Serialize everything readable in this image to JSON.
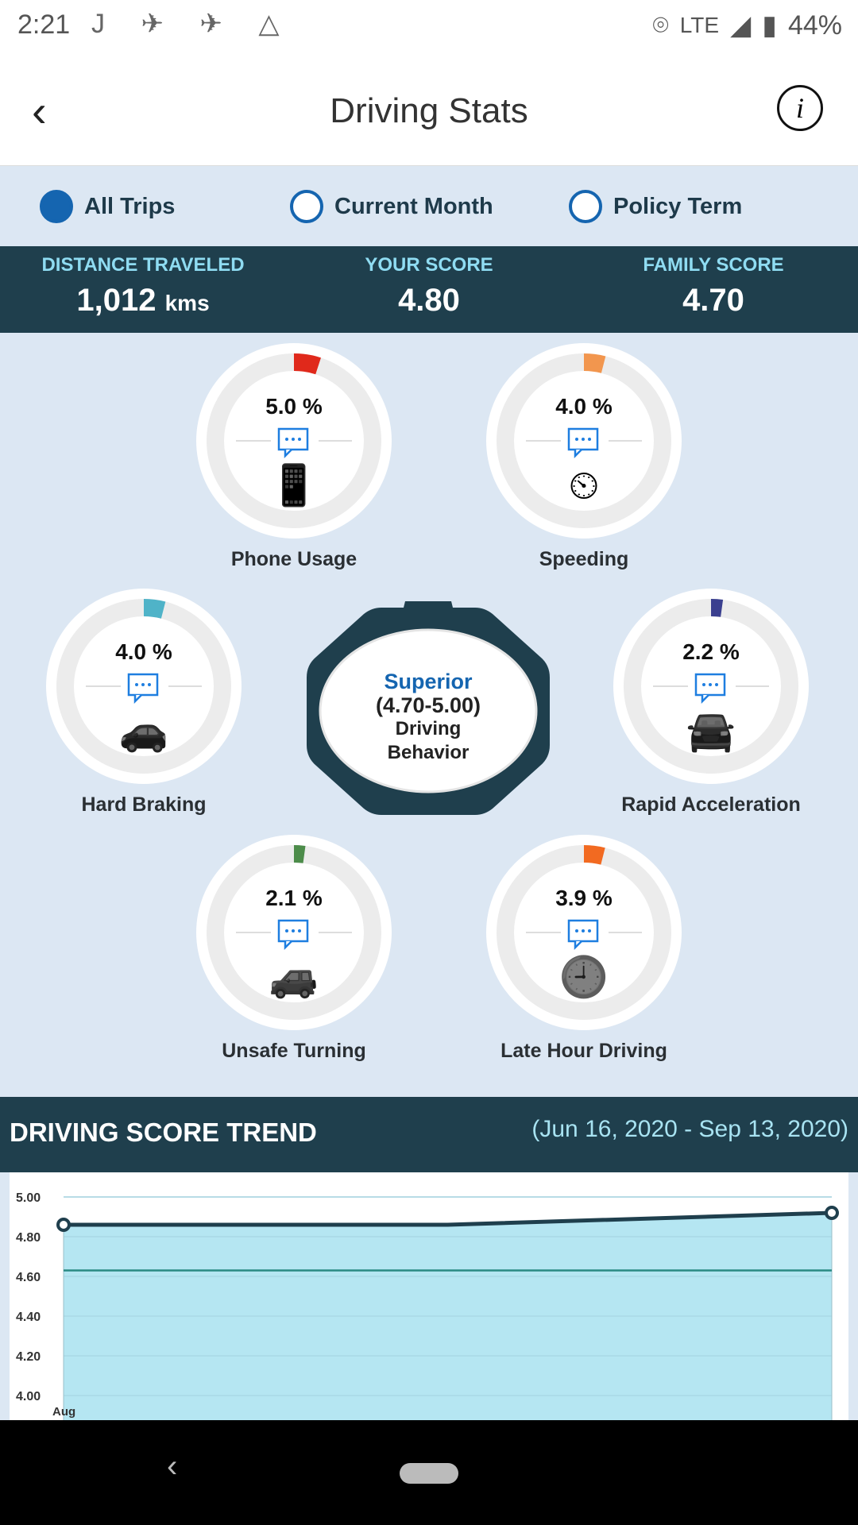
{
  "status": {
    "time": "2:21",
    "icons": "J ✈ ✈ △",
    "network": "LTE",
    "battery": "44%"
  },
  "header": {
    "back": "‹",
    "title": "Driving Stats",
    "info": "i"
  },
  "filters": [
    {
      "label": "All Trips",
      "selected": true
    },
    {
      "label": "Current Month",
      "selected": false
    },
    {
      "label": "Policy Term",
      "selected": false
    }
  ],
  "summary": {
    "distance_label": "DISTANCE TRAVELED",
    "distance_value": "1,012",
    "distance_unit": "kms",
    "score_label": "YOUR SCORE",
    "score_value": "4.80",
    "family_label": "FAMILY SCORE",
    "family_value": "4.70"
  },
  "gauges": [
    {
      "name": "Phone Usage",
      "pct_text": "5.0 %",
      "value": 5.0,
      "color": "#e0291b",
      "icon": "phone-touch-icon"
    },
    {
      "name": "Speeding",
      "pct_text": "4.0 %",
      "value": 4.0,
      "color": "#f2964e",
      "icon": "speedometer-warning-icon"
    },
    {
      "name": "Hard Braking",
      "pct_text": "4.0 %",
      "value": 4.0,
      "color": "#4fb3c8",
      "icon": "car-braking-icon"
    },
    {
      "name": "Rapid Acceleration",
      "pct_text": "2.2 %",
      "value": 2.2,
      "color": "#3a3f8f",
      "icon": "car-accelerating-icon"
    },
    {
      "name": "Unsafe Turning",
      "pct_text": "2.1 %",
      "value": 2.1,
      "color": "#4c8c4a",
      "icon": "car-turning-icon"
    },
    {
      "name": "Late Hour Driving",
      "pct_text": "3.9 %",
      "value": 3.9,
      "color": "#f26a21",
      "icon": "clock-icon"
    }
  ],
  "behavior": {
    "rating": "Superior",
    "range": "(4.70-5.00)",
    "line1": "Driving",
    "line2": "Behavior"
  },
  "trend": {
    "title": "DRIVING SCORE TREND",
    "date_range": "(Jun 16, 2020 - Sep 13, 2020)"
  },
  "chart_data": {
    "type": "area",
    "x": [
      "Aug",
      "",
      ""
    ],
    "x_tick_labels": [
      "Aug"
    ],
    "series": [
      {
        "values": [
          4.86,
          4.86,
          4.92
        ],
        "color": "#1f3f4d",
        "fill": "#b5e6f2"
      }
    ],
    "reference_line": {
      "value": 4.63,
      "color": "#2a8a83"
    },
    "ylim": [
      3.95,
      5.0
    ],
    "yticks": [
      "5.00",
      "4.80",
      "4.60",
      "4.40",
      "4.20",
      "4.00"
    ],
    "grid": true
  }
}
